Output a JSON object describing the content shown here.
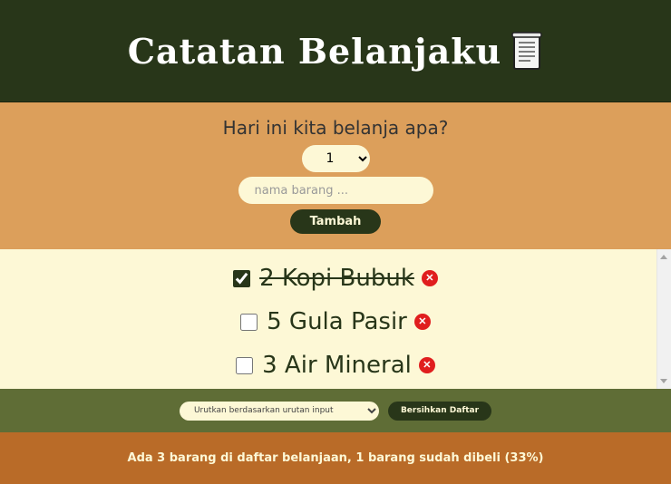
{
  "header": {
    "title": "Catatan Belanjaku",
    "icon": "page-icon"
  },
  "form": {
    "question": "Hari ini kita belanja apa?",
    "quantity_selected": "1",
    "name_placeholder": "nama barang ...",
    "add_label": "Tambah"
  },
  "items": [
    {
      "label": "2 Kopi Bubuk",
      "checked": true
    },
    {
      "label": "5 Gula Pasir",
      "checked": false
    },
    {
      "label": "3 Air Mineral",
      "checked": false
    }
  ],
  "actions": {
    "sort_selected": "Urutkan berdasarkan urutan input",
    "clear_label": "Bersihkan Daftar"
  },
  "footer": {
    "stats": "Ada 3 barang di daftar belanjaan, 1 barang sudah dibeli (33%)"
  },
  "colors": {
    "header_bg": "#283619",
    "form_bg": "#dc9f5b",
    "list_bg": "#fdf8d6",
    "actions_bg": "#5f6d36",
    "footer_bg": "#b96b28",
    "delete": "#e01e1e"
  }
}
